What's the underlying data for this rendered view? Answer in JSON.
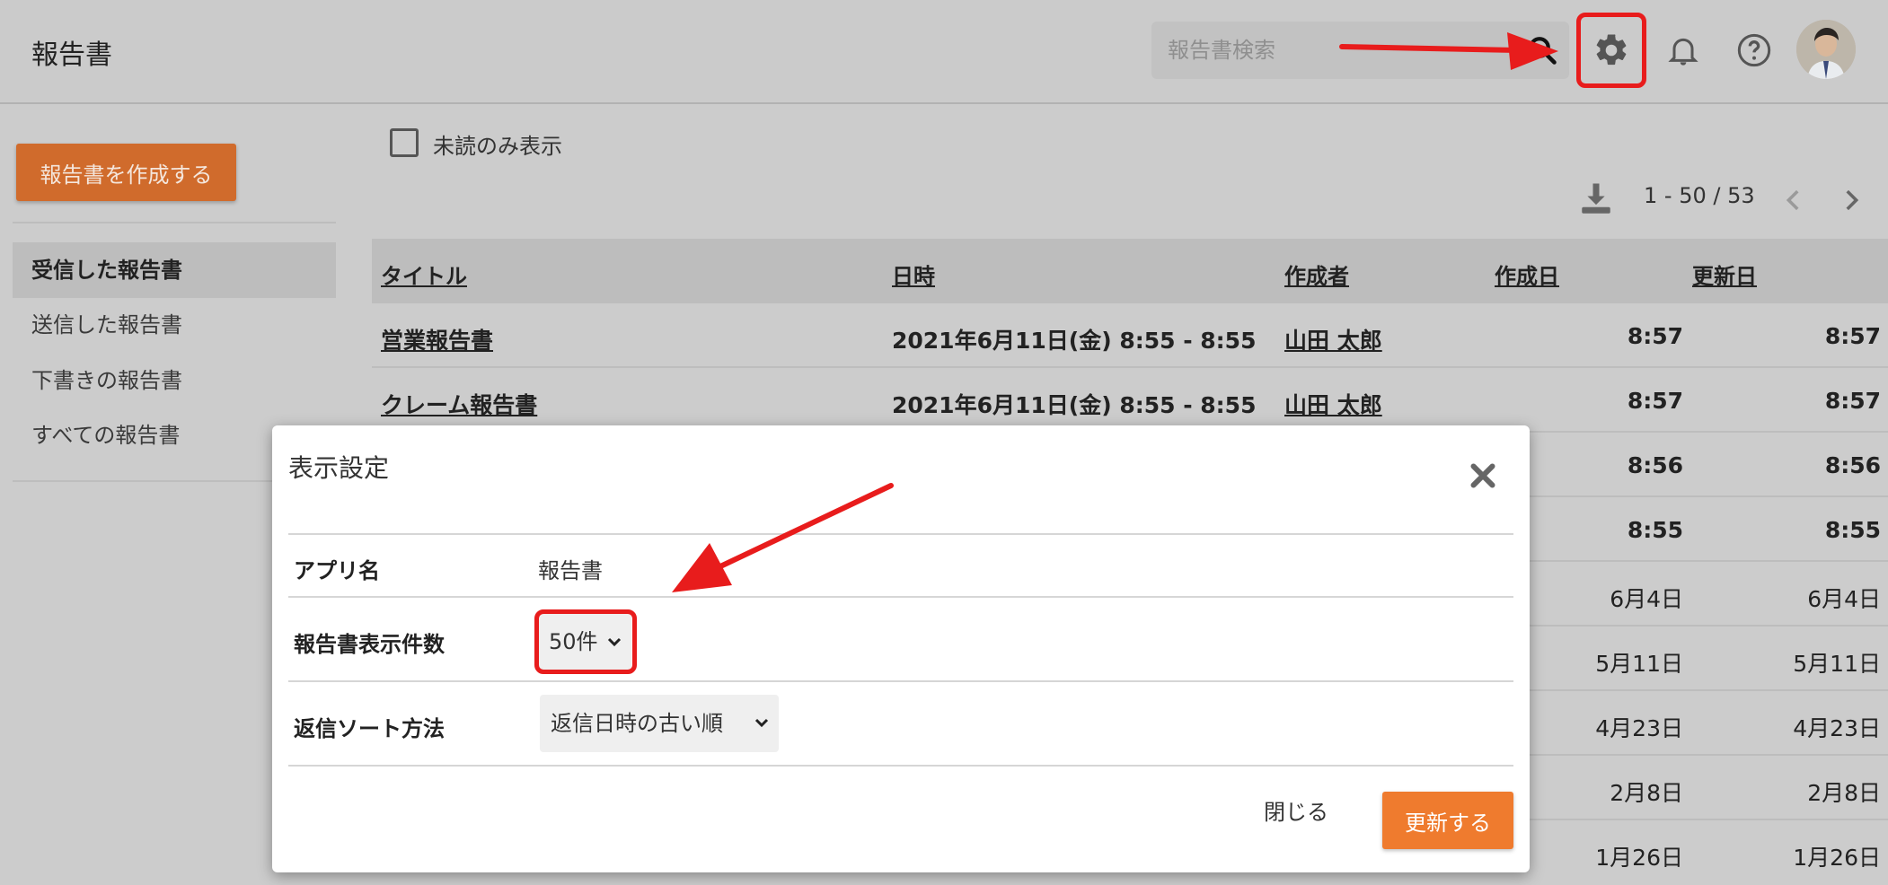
{
  "header": {
    "app_title": "報告書",
    "search_placeholder": "報告書検索",
    "icons": [
      "search-icon",
      "gear-icon",
      "bell-icon",
      "help-icon",
      "avatar"
    ]
  },
  "sidebar": {
    "create_button": "報告書を作成する",
    "items": [
      {
        "label": "受信した報告書",
        "active": true
      },
      {
        "label": "送信した報告書",
        "active": false
      },
      {
        "label": "下書きの報告書",
        "active": false
      },
      {
        "label": "すべての報告書",
        "active": false
      }
    ]
  },
  "toolbar": {
    "unread_only_label": "未読のみ表示",
    "pagination": "1 - 50 / 53"
  },
  "table": {
    "headers": {
      "title": "タイトル",
      "datetime": "日時",
      "author": "作成者",
      "created": "作成日",
      "updated": "更新日"
    },
    "rows": [
      {
        "title": "営業報告書",
        "datetime": "2021年6月11日(金) 8:55 - 8:55",
        "author": "山田 太郎",
        "created": "8:57",
        "updated": "8:57"
      },
      {
        "title": "クレーム報告書",
        "datetime": "2021年6月11日(金) 8:55 - 8:55",
        "author": "山田 太郎",
        "created": "8:57",
        "updated": "8:57"
      },
      {
        "created": "8:56",
        "updated": "8:56"
      },
      {
        "created": "8:55",
        "updated": "8:55"
      },
      {
        "created": "6月4日",
        "updated": "6月4日"
      },
      {
        "created": "5月11日",
        "updated": "5月11日"
      },
      {
        "created": "4月23日",
        "updated": "4月23日"
      },
      {
        "created": "2月8日",
        "updated": "2月8日"
      },
      {
        "created": "1月26日",
        "updated": "1月26日"
      }
    ]
  },
  "modal": {
    "title": "表示設定",
    "app_name_label": "アプリ名",
    "app_name_value": "報告書",
    "display_count_label": "報告書表示件数",
    "display_count_value": "50件",
    "reply_sort_label": "返信ソート方法",
    "reply_sort_value": "返信日時の古い順",
    "close_button": "閉じる",
    "update_button": "更新する"
  },
  "colors": {
    "accent": "#ef7b2e",
    "annotation": "#e81c1c"
  }
}
